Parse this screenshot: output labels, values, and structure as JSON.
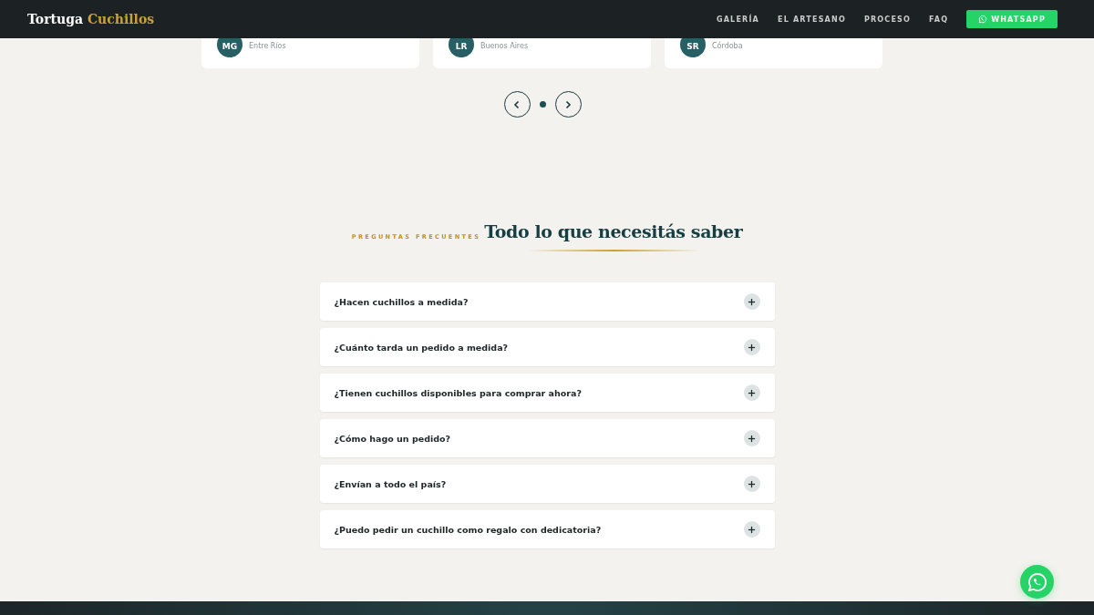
{
  "header": {
    "brand": {
      "first": "Tortuga",
      "second": "Cuchillos"
    },
    "nav": [
      "GALERÍA",
      "EL ARTESANO",
      "PROCESO",
      "FAQ"
    ],
    "cta": "WHATSAPP"
  },
  "testimonials": [
    {
      "initials": "MG",
      "place": "Entre Ríos"
    },
    {
      "initials": "LR",
      "place": "Buenos Aires"
    },
    {
      "initials": "SR",
      "place": "Córdoba"
    }
  ],
  "carousel": {
    "dots": [
      {
        "selected": true
      }
    ]
  },
  "faq": {
    "eyebrow": "PREGUNTAS FRECUENTES",
    "title": "Todo lo que necesitás saber",
    "items": [
      {
        "question": "¿Hacen cuchillos a medida?",
        "expanded": false
      },
      {
        "question": "¿Cuánto tarda un pedido a medida?",
        "expanded": false
      },
      {
        "question": "¿Tienen cuchillos disponibles para comprar ahora?",
        "expanded": false
      },
      {
        "question": "¿Cómo hago un pedido?",
        "expanded": false
      },
      {
        "question": "¿Envían a todo el país?",
        "expanded": false
      },
      {
        "question": "¿Puedo pedir un cuchillo como regalo con dedicatoria?",
        "expanded": false
      }
    ]
  }
}
